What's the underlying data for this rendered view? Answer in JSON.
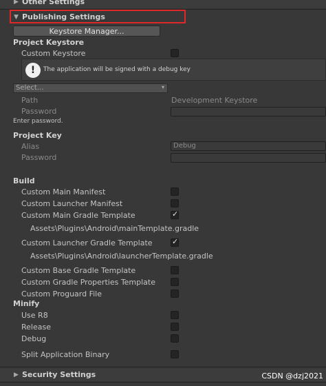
{
  "sections": {
    "other_settings": "Other Settings",
    "publishing_settings": "Publishing Settings",
    "security_settings": "Security Settings"
  },
  "keystore_manager_button": "Keystore Manager...",
  "project_keystore": {
    "header": "Project Keystore",
    "custom_keystore_label": "Custom Keystore",
    "custom_keystore_checked": false,
    "info_message": "The application will be signed with a debug key",
    "select_placeholder": "Select...",
    "path_label": "Path",
    "path_value": "Development Keystore",
    "password_label": "Password",
    "enter_password_hint": "Enter password."
  },
  "project_key": {
    "header": "Project Key",
    "alias_label": "Alias",
    "alias_value": "Debug",
    "password_label": "Password"
  },
  "build": {
    "header": "Build",
    "custom_main_manifest": "Custom Main Manifest",
    "custom_launcher_manifest": "Custom Launcher Manifest",
    "custom_main_gradle_template": "Custom Main Gradle Template",
    "main_template_path": "Assets\\Plugins\\Android\\mainTemplate.gradle",
    "custom_launcher_gradle_template": "Custom Launcher Gradle Template",
    "launcher_template_path": "Assets\\Plugins\\Android\\launcherTemplate.gradle",
    "custom_base_gradle_template": "Custom Base Gradle Template",
    "custom_gradle_properties_template": "Custom Gradle Properties Template",
    "custom_proguard_file": "Custom Proguard File",
    "checked": {
      "custom_main_manifest": false,
      "custom_launcher_manifest": false,
      "custom_main_gradle_template": true,
      "custom_launcher_gradle_template": true,
      "custom_base_gradle_template": false,
      "custom_gradle_properties_template": false,
      "custom_proguard_file": false
    }
  },
  "minify": {
    "header": "Minify",
    "use_r8": "Use R8",
    "release": "Release",
    "debug": "Debug"
  },
  "split_application_binary": "Split Application Binary",
  "check_glyph": "✓",
  "arrow_expanded": "▼",
  "arrow_collapsed": "▶",
  "info_glyph": "!",
  "chevron_glyph": "▾",
  "watermark": "CSDN @dzj2021",
  "colors": {
    "background": "#383838",
    "highlight_border": "#e0282a"
  }
}
